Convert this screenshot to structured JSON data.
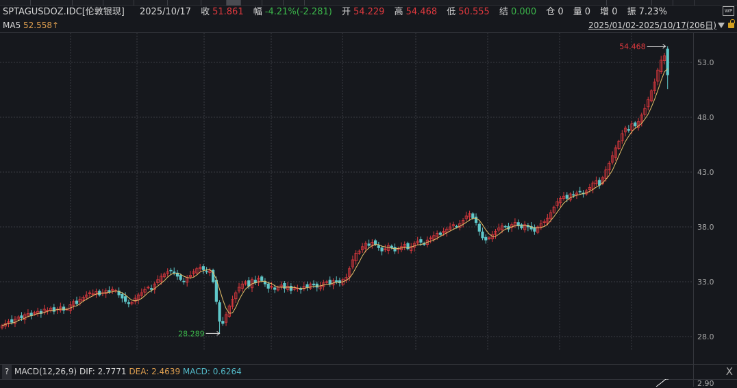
{
  "header": {
    "symbol": "SPTAGUSDOZ.IDC[伦敦银现]",
    "date": "2025/10/17",
    "close_label": "收",
    "close": "51.861",
    "change_label": "幅",
    "change": "-4.21%(-2.281)",
    "open_label": "开",
    "open": "54.229",
    "high_label": "高",
    "high": "54.468",
    "low_label": "低",
    "low": "50.555",
    "settle_label": "结",
    "settle": "0.000",
    "oi_label": "仓",
    "oi": "0",
    "vol_label": "量",
    "vol": "0",
    "inc_label": "增",
    "inc": "0",
    "amp_label": "振",
    "amp": "7.23%",
    "wp_label": "WP"
  },
  "indicator": {
    "ma_label": "MA5",
    "ma_value": "52.558↑"
  },
  "range": {
    "label": "2025/01/02-2025/10/17(206日)"
  },
  "icons": {
    "dropdown": "triangle-down-icon",
    "lock": "unlock-icon",
    "wp": "wp-icon"
  },
  "colors": {
    "up": "#e0393e",
    "down": "#5fc7c9",
    "ma5": "#e8c26a",
    "background": "#16181d"
  },
  "chart_data": {
    "type": "candlestick",
    "period": "daily",
    "yaxis_ticks": [
      28.0,
      33.0,
      38.0,
      43.0,
      48.0,
      53.0
    ],
    "ylim": [
      26.8,
      55.5
    ],
    "max_label": "54.468",
    "min_label": "28.289",
    "closes": [
      29.0,
      29.2,
      29.4,
      29.3,
      29.6,
      29.8,
      29.7,
      30.0,
      30.1,
      29.9,
      30.2,
      30.3,
      30.1,
      30.5,
      30.4,
      30.6,
      30.3,
      30.5,
      30.7,
      30.4,
      30.5,
      30.9,
      31.2,
      31.0,
      31.4,
      31.6,
      31.8,
      32.0,
      31.9,
      32.1,
      31.8,
      32.0,
      32.2,
      32.1,
      32.3,
      32.2,
      31.8,
      31.5,
      31.2,
      31.0,
      31.1,
      31.5,
      31.8,
      32.0,
      32.3,
      32.5,
      32.3,
      32.8,
      33.2,
      33.5,
      33.7,
      33.9,
      34.0,
      33.8,
      33.5,
      33.2,
      33.0,
      33.4,
      33.6,
      33.9,
      34.2,
      34.3,
      34.1,
      33.9,
      34.0,
      33.0,
      31.2,
      29.4,
      29.2,
      30.0,
      30.8,
      31.4,
      32.0,
      32.5,
      32.8,
      33.0,
      32.6,
      33.2,
      32.9,
      33.3,
      33.1,
      32.8,
      32.4,
      32.6,
      32.3,
      32.5,
      32.7,
      32.4,
      32.6,
      32.2,
      32.5,
      32.4,
      32.3,
      32.6,
      32.5,
      32.8,
      32.7,
      32.5,
      32.6,
      32.9,
      33.0,
      32.8,
      33.1,
      33.0,
      32.9,
      33.2,
      33.4,
      34.2,
      35.0,
      35.6,
      35.8,
      36.2,
      36.5,
      36.3,
      36.6,
      36.4,
      36.1,
      35.8,
      36.0,
      36.3,
      36.1,
      35.8,
      36.0,
      36.2,
      36.4,
      36.0,
      36.2,
      36.5,
      36.7,
      36.6,
      36.4,
      36.8,
      37.0,
      37.2,
      37.4,
      37.3,
      37.6,
      37.8,
      38.0,
      38.2,
      38.0,
      38.3,
      38.6,
      39.0,
      39.2,
      38.8,
      38.4,
      37.6,
      37.0,
      36.8,
      37.0,
      37.3,
      37.6,
      37.9,
      38.1,
      38.0,
      37.8,
      38.2,
      38.4,
      38.1,
      37.9,
      38.2,
      38.0,
      37.8,
      37.6,
      38.0,
      38.3,
      38.5,
      38.8,
      39.3,
      39.8,
      40.3,
      40.6,
      40.8,
      40.6,
      41.0,
      40.9,
      41.1,
      41.2,
      41.0,
      41.3,
      41.6,
      42.0,
      42.2,
      41.8,
      42.5,
      43.2,
      43.8,
      44.5,
      45.2,
      45.8,
      46.5,
      47.0,
      46.8,
      47.4,
      47.2,
      47.6,
      48.2,
      48.8,
      49.6,
      50.4,
      51.2,
      52.3,
      53.2,
      53.6,
      51.861
    ],
    "special": {
      "min_index": 67,
      "min_low": 28.289,
      "last": {
        "open": 54.229,
        "high": 54.468,
        "low": 50.555,
        "close": 51.861
      }
    },
    "ma_period": 5
  },
  "macd": {
    "help": "?",
    "title": "MACD(12,26,9)",
    "dif": "DIF: 2.7771",
    "dea": "DEA: 2.4639",
    "macd": "MACD: 0.6264",
    "close": "X",
    "tick": "2.90"
  }
}
